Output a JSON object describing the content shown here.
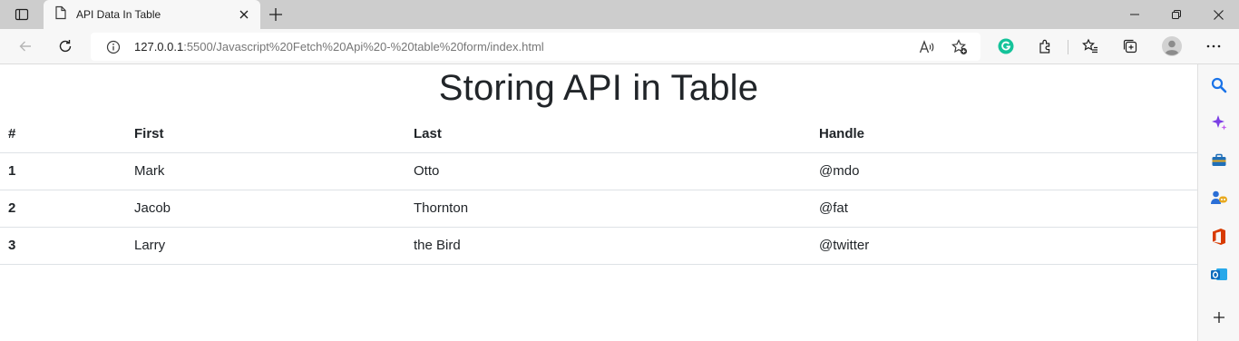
{
  "browser": {
    "tab": {
      "title": "API Data In Table"
    },
    "address_bar": {
      "url_host": "127.0.0.1",
      "url_rest": ":5500/Javascript%20Fetch%20Api%20-%20table%20form/index.html"
    },
    "icons": {
      "tab_actions": "tab-actions-icon",
      "tab_favicon": "document-icon",
      "tab_close": "close-icon",
      "new_tab": "plus-icon",
      "minimize": "minimize-icon",
      "restore": "restore-icon",
      "close_window": "close-icon",
      "back": "back-arrow-icon",
      "refresh": "refresh-icon",
      "site_info": "info-icon",
      "read_aloud": "read-aloud-icon",
      "add_favorite": "star-add-icon",
      "grammarly": "grammarly-icon",
      "extensions": "puzzle-icon",
      "favorites": "favorites-icon",
      "collections": "collections-icon",
      "profile": "profile-avatar",
      "more": "more-icon"
    },
    "sidebar": [
      "search-icon",
      "copilot-icon",
      "tools-icon",
      "games-icon",
      "office-icon",
      "outlook-icon",
      "add-icon"
    ],
    "colors": {
      "grammarly": "#15c39a",
      "copilot": "#7b3fe4",
      "office": "#d83b01",
      "outlook": "#0f6cbd",
      "search": "#1a73e8"
    }
  },
  "page": {
    "title": "Storing API in Table",
    "table": {
      "headers": [
        "#",
        "First",
        "Last",
        "Handle"
      ],
      "rows": [
        [
          "1",
          "Mark",
          "Otto",
          "@mdo"
        ],
        [
          "2",
          "Jacob",
          "Thornton",
          "@fat"
        ],
        [
          "3",
          "Larry",
          "the Bird",
          "@twitter"
        ]
      ]
    }
  }
}
